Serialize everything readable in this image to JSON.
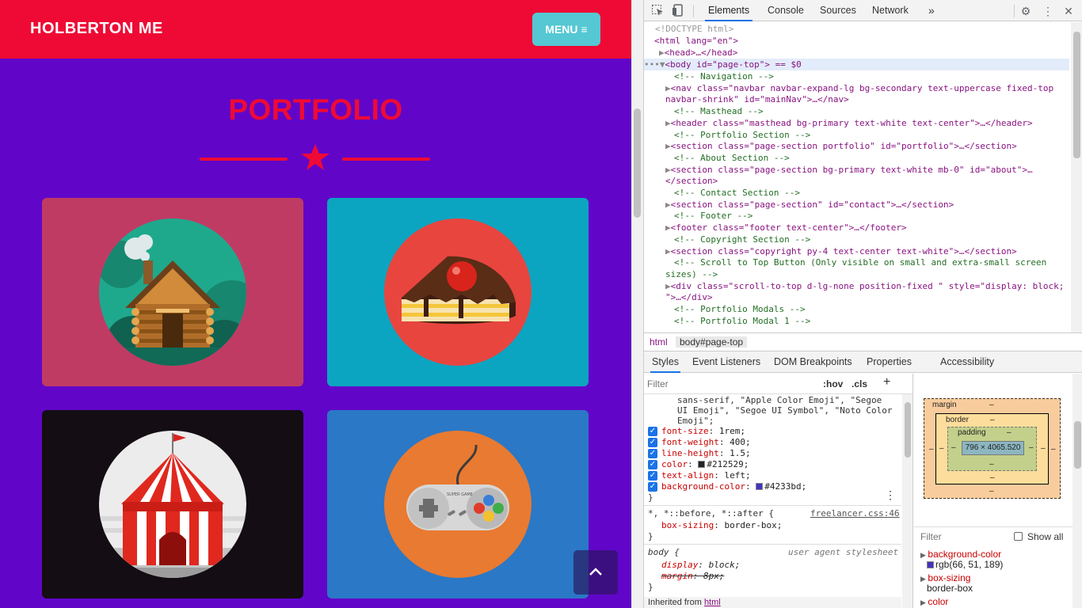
{
  "site": {
    "brand": "HOLBERTON ME",
    "menu_label": "MENU",
    "portfolio_title": "PORTFOLIO",
    "cards": [
      {
        "name": "cabin",
        "bg": "#c03b64",
        "icon": "cabin-icon"
      },
      {
        "name": "cake",
        "bg": "#0ba5c1",
        "icon": "cake-icon"
      },
      {
        "name": "circus",
        "bg": "#140d13",
        "icon": "circus-tent-icon"
      },
      {
        "name": "game",
        "bg": "#2a78c6",
        "icon": "game-controller-icon"
      }
    ],
    "game_controller_text": "SUPER GAME",
    "colors": {
      "nav": "#ee0a35",
      "body": "#6106c9",
      "menu": "#55c8d3",
      "accent": "#ee0a35"
    }
  },
  "devtools": {
    "tabs": [
      "Elements",
      "Console",
      "Sources",
      "Network"
    ],
    "more": "»",
    "dom": {
      "doctype": "<!DOCTYPE html>",
      "html_open": "<html lang=\"en\">",
      "head": "<head>…</head>",
      "body_selected": "<body id=\"page-top\"> == $0",
      "lines": [
        {
          "text": "<!-- Navigation -->",
          "type": "comment"
        },
        {
          "text": "<nav class=\"navbar navbar-expand-lg bg-secondary text-uppercase fixed-top",
          "type": "tag"
        },
        {
          "text": "navbar-shrink\" id=\"mainNav\">…</nav>",
          "type": "tag-cont"
        },
        {
          "text": "<!-- Masthead -->",
          "type": "comment"
        },
        {
          "text": "<header class=\"masthead bg-primary text-white text-center\">…</header>",
          "type": "tag"
        },
        {
          "text": "<!-- Portfolio Section -->",
          "type": "comment"
        },
        {
          "text": "<section class=\"page-section portfolio\" id=\"portfolio\">…</section>",
          "type": "tag"
        },
        {
          "text": "<!-- About Section -->",
          "type": "comment"
        },
        {
          "text": "<section class=\"page-section bg-primary text-white mb-0\" id=\"about\">…",
          "type": "tag"
        },
        {
          "text": "</section>",
          "type": "tag-cont"
        },
        {
          "text": "<!-- Contact Section -->",
          "type": "comment"
        },
        {
          "text": "<section class=\"page-section\" id=\"contact\">…</section>",
          "type": "tag"
        },
        {
          "text": "<!-- Footer -->",
          "type": "comment"
        },
        {
          "text": "<footer class=\"footer text-center\">…</footer>",
          "type": "tag"
        },
        {
          "text": "<!-- Copyright Section -->",
          "type": "comment"
        },
        {
          "text": "<section class=\"copyright py-4 text-center text-white\">…</section>",
          "type": "tag"
        },
        {
          "text": "<!-- Scroll to Top Button (Only visible on small and extra-small screen",
          "type": "comment"
        },
        {
          "text": "sizes) -->",
          "type": "comment-cont"
        },
        {
          "text": "<div class=\"scroll-to-top d-lg-none position-fixed \" style=\"display: block;",
          "type": "tag"
        },
        {
          "text": "\">…</div>",
          "type": "tag-cont"
        },
        {
          "text": "<!-- Portfolio Modals -->",
          "type": "comment"
        },
        {
          "text": "<!-- Portfolio Modal 1 -->",
          "type": "comment"
        }
      ]
    },
    "breadcrumb": [
      "html",
      "body#page-top"
    ],
    "subtabs": [
      "Styles",
      "Event Listeners",
      "DOM Breakpoints",
      "Properties",
      "Accessibility"
    ],
    "styles": {
      "filter_placeholder": "Filter",
      "hov": ":hov",
      "cls": ".cls",
      "font_stack_1": "sans-serif, \"Apple Color Emoji\", \"Segoe",
      "font_stack_2": "UI Emoji\", \"Segoe UI Symbol\", \"Noto Color",
      "font_stack_3": "Emoji\";",
      "props": [
        {
          "name": "font-size",
          "value": "1rem;"
        },
        {
          "name": "font-weight",
          "value": "400;"
        },
        {
          "name": "line-height",
          "value": "1.5;"
        },
        {
          "name": "color",
          "value": "#212529;",
          "swatch": "#212529"
        },
        {
          "name": "text-align",
          "value": "left;"
        },
        {
          "name": "background-color",
          "value": "#4233bd;",
          "swatch": "#4233bd"
        }
      ],
      "close_brace": "}",
      "universal_selector": "*, *::before, *::after {",
      "universal_source": "freelancer.css:46",
      "box_sizing": {
        "name": "box-sizing",
        "value": "border-box;"
      },
      "body_selector": "body {",
      "body_source": "user agent stylesheet",
      "display": {
        "name": "display",
        "value": "block;"
      },
      "margin": {
        "name": "margin",
        "value": "8px;"
      },
      "inherited_label": "Inherited from",
      "inherited_from": "html"
    },
    "computed": {
      "margin_label": "margin",
      "border_label": "border",
      "padding_label": "padding",
      "content_size": "796 × 4065.520",
      "dash": "–",
      "filter_placeholder": "Filter",
      "show_all": "Show all",
      "props": [
        {
          "name": "background-color",
          "value": "rgb(66, 51, 189)",
          "swatch": "#4233bd"
        },
        {
          "name": "box-sizing",
          "value": "border-box"
        },
        {
          "name": "color",
          "value": ""
        }
      ]
    }
  }
}
